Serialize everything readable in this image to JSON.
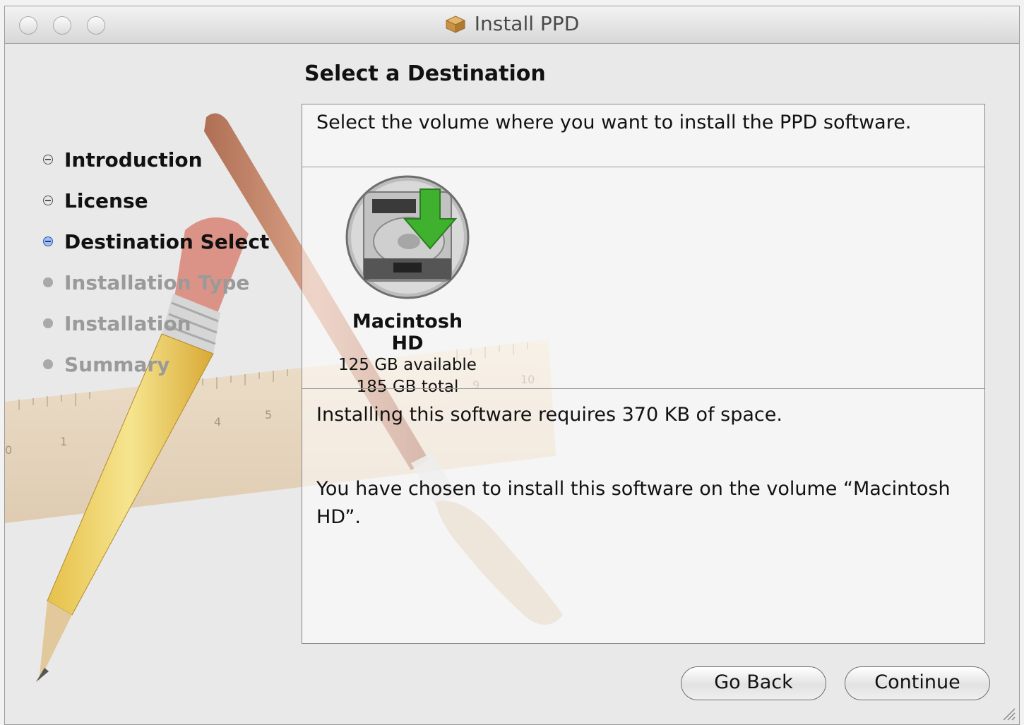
{
  "window": {
    "title": "Install PPD"
  },
  "heading": "Select a Destination",
  "steps": [
    {
      "label": "Introduction",
      "state": "done"
    },
    {
      "label": "License",
      "state": "done"
    },
    {
      "label": "Destination Select",
      "state": "current"
    },
    {
      "label": "Installation Type",
      "state": "pending"
    },
    {
      "label": "Installation",
      "state": "pending"
    },
    {
      "label": "Summary",
      "state": "pending"
    }
  ],
  "panel": {
    "prompt": "Select the volume where you want to install the PPD software.",
    "volume": {
      "name": "Macintosh HD",
      "available": "125 GB available",
      "total": "185 GB total"
    },
    "space_required": "Installing this software requires 370 KB of space.",
    "chosen": "You have chosen to install this software on the volume “Macintosh HD”."
  },
  "buttons": {
    "back": "Go Back",
    "continue": "Continue"
  },
  "colors": {
    "accent_arrow": "#3fb12f",
    "current_step": "#4a7fd4"
  }
}
